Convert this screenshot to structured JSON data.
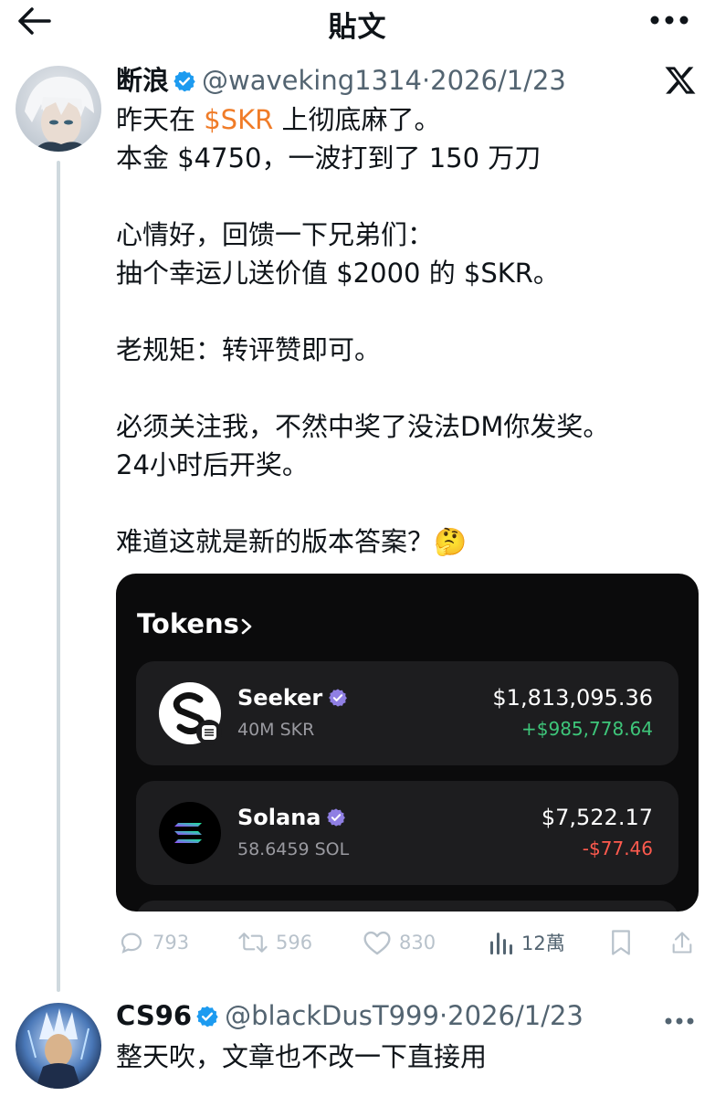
{
  "topbar": {
    "title": "貼文"
  },
  "tweet1": {
    "display_name": "断浪",
    "handle": "@waveking1314",
    "separator": "·",
    "date": "2026/1/23",
    "text_lines": [
      {
        "before": "昨天在 ",
        "cashtag": "$SKR",
        "after": " 上彻底麻了。"
      },
      "本金 $4750，一波打到了 150 万刀",
      "",
      "心情好，回馈一下兄弟们：",
      "抽个幸运儿送价值 $2000 的 $SKR。",
      "",
      "老规矩：转评赞即可。",
      "",
      "必须关注我，不然中奖了没法DM你发奖。",
      "24小时后开奖。",
      "",
      "难道这就是新的版本答案？🤔"
    ],
    "card": {
      "title": "Tokens",
      "tokens": [
        {
          "name": "Seeker",
          "amount": "40M SKR",
          "value": "$1,813,095.36",
          "change": "+$985,778.64"
        },
        {
          "name": "Solana",
          "amount": "58.6459 SOL",
          "value": "$7,522.17",
          "change": "-$77.46"
        }
      ]
    },
    "actions": {
      "replies": "793",
      "retweets": "596",
      "likes": "830",
      "views": "12萬"
    }
  },
  "tweet2": {
    "display_name": "CS96",
    "handle": "@blackDusT999",
    "separator": "·",
    "date": "2026/1/23",
    "text": "整天吹，文章也不改一下直接用"
  },
  "colors": {
    "cashtag": "#f07c28",
    "verified": "#1d9bf0",
    "positive": "#3ec67a",
    "negative": "#ff5a4e",
    "card_bg": "#0b0b0c"
  }
}
